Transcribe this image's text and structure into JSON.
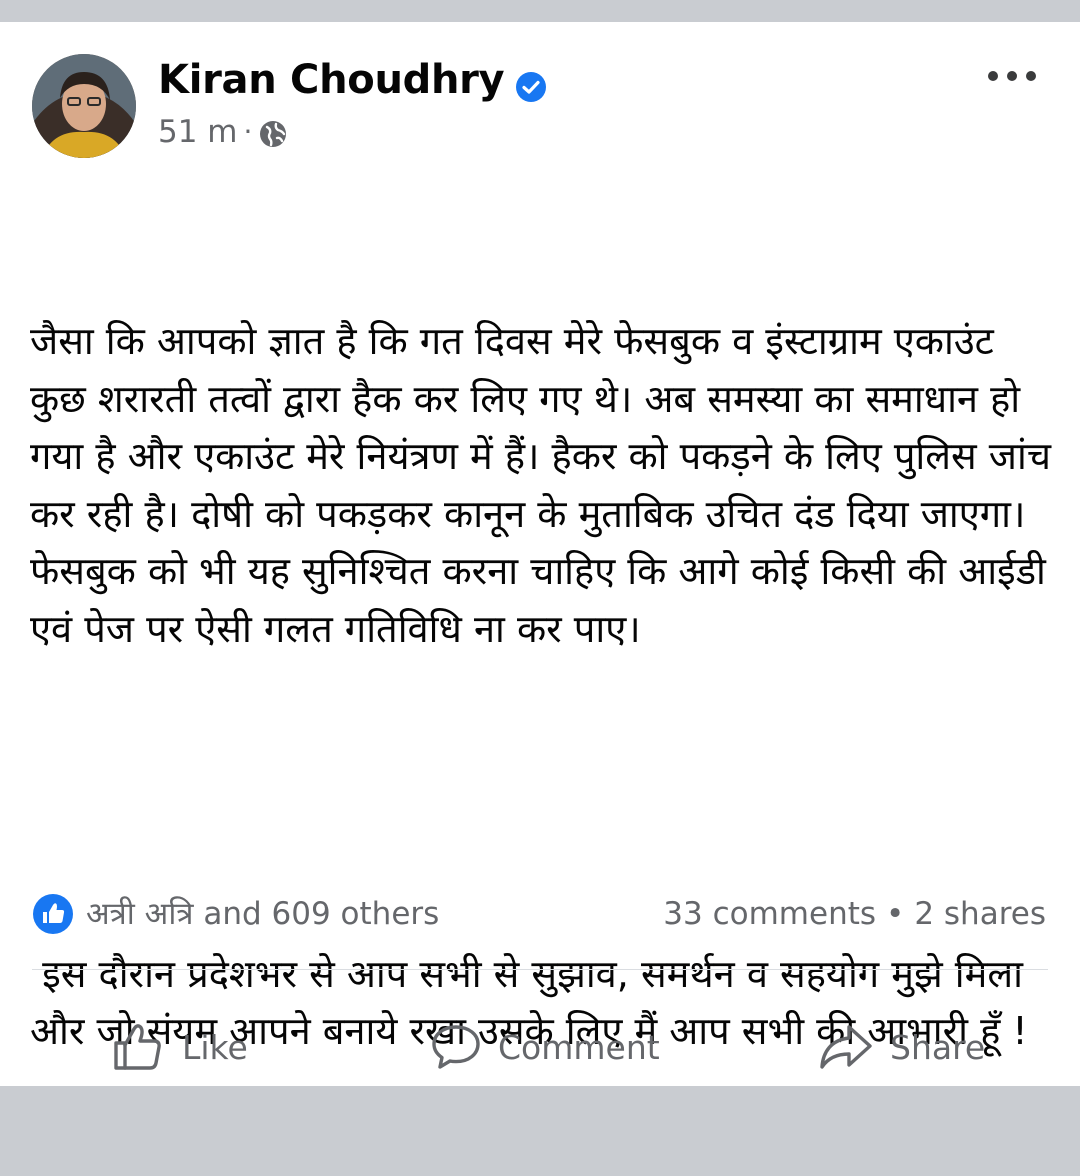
{
  "post": {
    "author": "Kiran Choudhry",
    "time": "51 m",
    "separator": "·",
    "paragraphs": [
      "जैसा कि आपको ज्ञात है कि गत दिवस मेरे फेसबुक व इंस्टाग्राम एकाउंट कुछ शरारती तत्वों द्वारा हैक कर लिए गए थे। अब समस्या का समाधान हो गया है और एकाउंट मेरे नियंत्रण में हैं। हैकर को पकड़ने के लिए पुलिस जांच कर रही है। दोषी को पकड़कर कानून के मुताबिक उचित दंड दिया जाएगा। फेसबुक को भी यह सुनिश्चित करना चाहिए कि आगे कोई किसी की आईडी एवं पेज पर ऐसी गलत गतिविधि ना कर पाए।",
      " इस दौरान प्रदेशभर से आप सभी से सुझाव, समर्थन व सहयोग मुझे मिला और जो संयम आपने बनाये रखा उसके लिए मैं आप सभी की आभारी हूँ !"
    ]
  },
  "stats": {
    "reactions_text": "अत्री अत्रि and 609 others",
    "comments": "33 comments",
    "bullet": "•",
    "shares": "2 shares"
  },
  "actions": {
    "like": "Like",
    "comment": "Comment",
    "share": "Share"
  },
  "colors": {
    "accent": "#1877f2",
    "secondary_text": "#65676b",
    "page_background": "#c9ccd1"
  },
  "icons": {
    "verified": "verified-badge-icon",
    "privacy": "globe-icon",
    "more": "more-options-icon",
    "reaction": "like-reaction-icon",
    "like": "thumbs-up-outline-icon",
    "comment": "speech-bubble-icon",
    "share": "share-arrow-icon"
  }
}
